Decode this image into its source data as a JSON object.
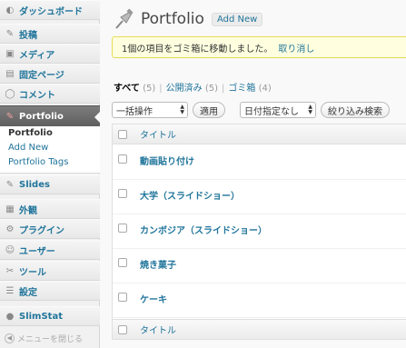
{
  "sidebar": {
    "items": [
      {
        "label": "ダッシュボード",
        "icon": "dashboard-icon"
      },
      {
        "label": "投稿",
        "icon": "pin-icon"
      },
      {
        "label": "メディア",
        "icon": "media-icon"
      },
      {
        "label": "固定ページ",
        "icon": "pages-icon"
      },
      {
        "label": "コメント",
        "icon": "comment-icon"
      },
      {
        "label": "Portfolio",
        "icon": "pin-icon",
        "current": true
      },
      {
        "label": "Slides",
        "icon": "pin-icon"
      },
      {
        "label": "外観",
        "icon": "appearance-icon"
      },
      {
        "label": "プラグイン",
        "icon": "plugin-icon"
      },
      {
        "label": "ユーザー",
        "icon": "users-icon"
      },
      {
        "label": "ツール",
        "icon": "tools-icon"
      },
      {
        "label": "設定",
        "icon": "settings-icon"
      },
      {
        "label": "SlimStat",
        "icon": "stats-icon"
      }
    ],
    "submenu": [
      "Portfolio",
      "Add New",
      "Portfolio Tags"
    ],
    "collapse_label": "メニューを閉じる"
  },
  "header": {
    "title": "Portfolio",
    "add_new": "Add New"
  },
  "notice": {
    "message": "1個の項目をゴミ箱に移動しました。",
    "undo": "取り消し"
  },
  "views": {
    "all": "すべて",
    "all_count": "(5)",
    "published": "公開済み",
    "published_count": "(5)",
    "trash": "ゴミ箱",
    "trash_count": "(4)"
  },
  "actions": {
    "bulk_select": "一括操作",
    "apply": "適用",
    "date_select": "日付指定なし",
    "filter": "絞り込み検索"
  },
  "table": {
    "column_title": "タイトル",
    "rows": [
      "動画貼り付け",
      "大学（スライドショー）",
      "カンボジア（スライドショー）",
      "焼き菓子",
      "ケーキ"
    ]
  },
  "colors": {
    "link": "#21759b",
    "notice_bg": "#ffffe0",
    "active_menu": "#6d6d6d"
  }
}
